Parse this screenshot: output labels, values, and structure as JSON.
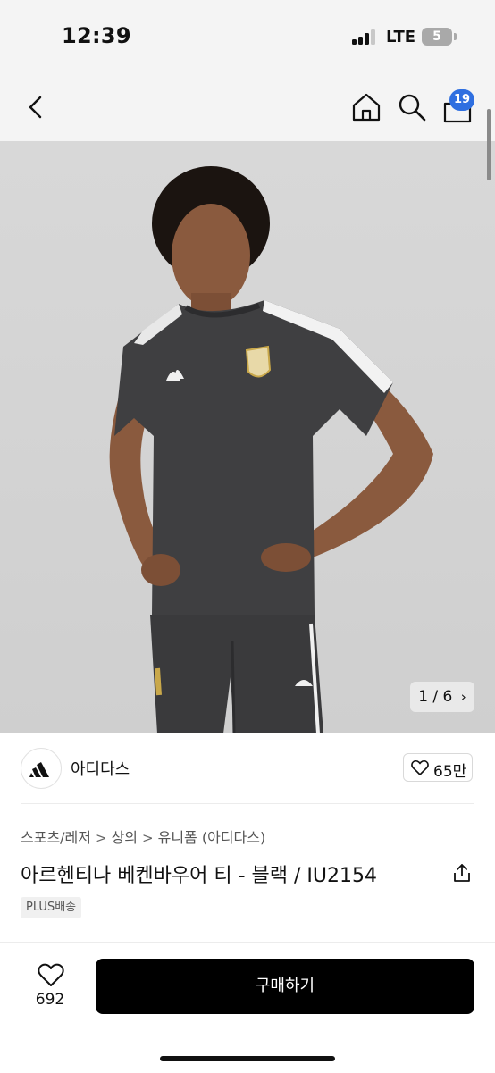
{
  "status_bar": {
    "time": "12:39",
    "network": "LTE",
    "battery_level": "5"
  },
  "nav": {
    "back_icon": "chevron-left-icon",
    "home_icon": "home-icon",
    "search_icon": "search-icon",
    "cart_icon": "shopping-bag-icon",
    "cart_badge": "19"
  },
  "gallery": {
    "counter": "1 / 6",
    "next_icon": "chevron-right-icon"
  },
  "brand": {
    "name": "아디다스",
    "like_count": "65만"
  },
  "breadcrumb": [
    "스포츠/레저",
    "상의",
    "유니폼 (아디다스)"
  ],
  "product": {
    "title": "아르헨티나 베켄바우어 티 - 블랙 / IU2154",
    "delivery_badge": "PLUS배송"
  },
  "bottom_bar": {
    "wish_count": "692",
    "buy_label": "구매하기"
  },
  "colors": {
    "accent_badge": "#2f6fe0",
    "buy_button": "#000000",
    "image_bg": "#d4d4d4",
    "shirt": "#3f3f41"
  }
}
